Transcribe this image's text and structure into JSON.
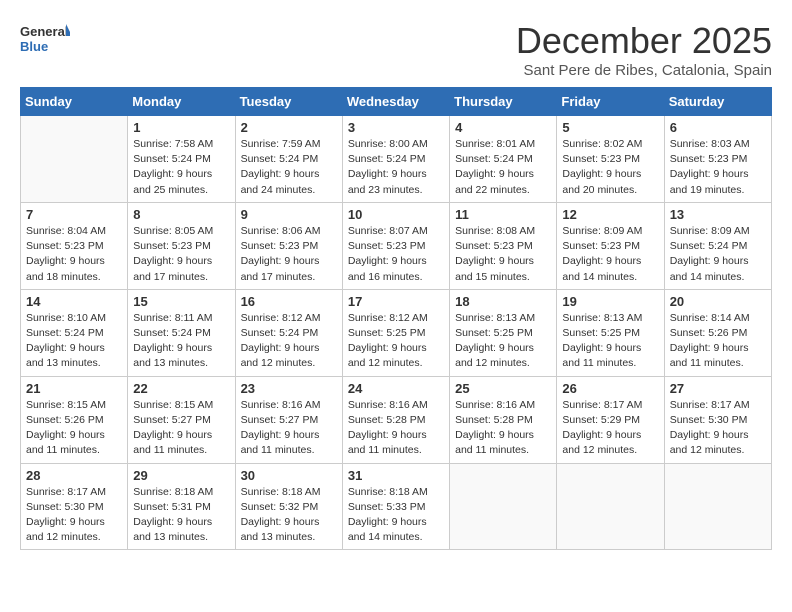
{
  "logo": {
    "general": "General",
    "blue": "Blue"
  },
  "title": "December 2025",
  "subtitle": "Sant Pere de Ribes, Catalonia, Spain",
  "days_of_week": [
    "Sunday",
    "Monday",
    "Tuesday",
    "Wednesday",
    "Thursday",
    "Friday",
    "Saturday"
  ],
  "weeks": [
    [
      {
        "day": "",
        "info": ""
      },
      {
        "day": "1",
        "info": "Sunrise: 7:58 AM\nSunset: 5:24 PM\nDaylight: 9 hours\nand 25 minutes."
      },
      {
        "day": "2",
        "info": "Sunrise: 7:59 AM\nSunset: 5:24 PM\nDaylight: 9 hours\nand 24 minutes."
      },
      {
        "day": "3",
        "info": "Sunrise: 8:00 AM\nSunset: 5:24 PM\nDaylight: 9 hours\nand 23 minutes."
      },
      {
        "day": "4",
        "info": "Sunrise: 8:01 AM\nSunset: 5:24 PM\nDaylight: 9 hours\nand 22 minutes."
      },
      {
        "day": "5",
        "info": "Sunrise: 8:02 AM\nSunset: 5:23 PM\nDaylight: 9 hours\nand 20 minutes."
      },
      {
        "day": "6",
        "info": "Sunrise: 8:03 AM\nSunset: 5:23 PM\nDaylight: 9 hours\nand 19 minutes."
      }
    ],
    [
      {
        "day": "7",
        "info": "Sunrise: 8:04 AM\nSunset: 5:23 PM\nDaylight: 9 hours\nand 18 minutes."
      },
      {
        "day": "8",
        "info": "Sunrise: 8:05 AM\nSunset: 5:23 PM\nDaylight: 9 hours\nand 17 minutes."
      },
      {
        "day": "9",
        "info": "Sunrise: 8:06 AM\nSunset: 5:23 PM\nDaylight: 9 hours\nand 17 minutes."
      },
      {
        "day": "10",
        "info": "Sunrise: 8:07 AM\nSunset: 5:23 PM\nDaylight: 9 hours\nand 16 minutes."
      },
      {
        "day": "11",
        "info": "Sunrise: 8:08 AM\nSunset: 5:23 PM\nDaylight: 9 hours\nand 15 minutes."
      },
      {
        "day": "12",
        "info": "Sunrise: 8:09 AM\nSunset: 5:23 PM\nDaylight: 9 hours\nand 14 minutes."
      },
      {
        "day": "13",
        "info": "Sunrise: 8:09 AM\nSunset: 5:24 PM\nDaylight: 9 hours\nand 14 minutes."
      }
    ],
    [
      {
        "day": "14",
        "info": "Sunrise: 8:10 AM\nSunset: 5:24 PM\nDaylight: 9 hours\nand 13 minutes."
      },
      {
        "day": "15",
        "info": "Sunrise: 8:11 AM\nSunset: 5:24 PM\nDaylight: 9 hours\nand 13 minutes."
      },
      {
        "day": "16",
        "info": "Sunrise: 8:12 AM\nSunset: 5:24 PM\nDaylight: 9 hours\nand 12 minutes."
      },
      {
        "day": "17",
        "info": "Sunrise: 8:12 AM\nSunset: 5:25 PM\nDaylight: 9 hours\nand 12 minutes."
      },
      {
        "day": "18",
        "info": "Sunrise: 8:13 AM\nSunset: 5:25 PM\nDaylight: 9 hours\nand 12 minutes."
      },
      {
        "day": "19",
        "info": "Sunrise: 8:13 AM\nSunset: 5:25 PM\nDaylight: 9 hours\nand 11 minutes."
      },
      {
        "day": "20",
        "info": "Sunrise: 8:14 AM\nSunset: 5:26 PM\nDaylight: 9 hours\nand 11 minutes."
      }
    ],
    [
      {
        "day": "21",
        "info": "Sunrise: 8:15 AM\nSunset: 5:26 PM\nDaylight: 9 hours\nand 11 minutes."
      },
      {
        "day": "22",
        "info": "Sunrise: 8:15 AM\nSunset: 5:27 PM\nDaylight: 9 hours\nand 11 minutes."
      },
      {
        "day": "23",
        "info": "Sunrise: 8:16 AM\nSunset: 5:27 PM\nDaylight: 9 hours\nand 11 minutes."
      },
      {
        "day": "24",
        "info": "Sunrise: 8:16 AM\nSunset: 5:28 PM\nDaylight: 9 hours\nand 11 minutes."
      },
      {
        "day": "25",
        "info": "Sunrise: 8:16 AM\nSunset: 5:28 PM\nDaylight: 9 hours\nand 11 minutes."
      },
      {
        "day": "26",
        "info": "Sunrise: 8:17 AM\nSunset: 5:29 PM\nDaylight: 9 hours\nand 12 minutes."
      },
      {
        "day": "27",
        "info": "Sunrise: 8:17 AM\nSunset: 5:30 PM\nDaylight: 9 hours\nand 12 minutes."
      }
    ],
    [
      {
        "day": "28",
        "info": "Sunrise: 8:17 AM\nSunset: 5:30 PM\nDaylight: 9 hours\nand 12 minutes."
      },
      {
        "day": "29",
        "info": "Sunrise: 8:18 AM\nSunset: 5:31 PM\nDaylight: 9 hours\nand 13 minutes."
      },
      {
        "day": "30",
        "info": "Sunrise: 8:18 AM\nSunset: 5:32 PM\nDaylight: 9 hours\nand 13 minutes."
      },
      {
        "day": "31",
        "info": "Sunrise: 8:18 AM\nSunset: 5:33 PM\nDaylight: 9 hours\nand 14 minutes."
      },
      {
        "day": "",
        "info": ""
      },
      {
        "day": "",
        "info": ""
      },
      {
        "day": "",
        "info": ""
      }
    ]
  ]
}
